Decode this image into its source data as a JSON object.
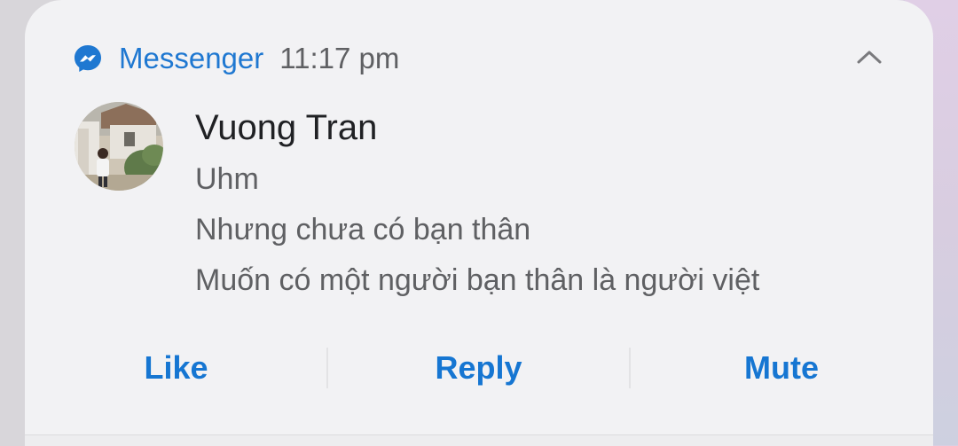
{
  "notification": {
    "app_name": "Messenger",
    "time": "11:17 pm",
    "app_icon": "messenger-icon",
    "collapse_icon": "chevron-up-icon",
    "sender": "Vuong Tran",
    "messages": [
      "Uhm",
      "Nhưng chưa có bạn thân",
      "Muốn có một người bạn thân là người việt"
    ],
    "actions": {
      "like": "Like",
      "reply": "Reply",
      "mute": "Mute"
    }
  },
  "colors": {
    "accent": "#1676d2",
    "app_name": "#1f78d1",
    "card": "#f2f2f4",
    "sender": "#202124",
    "body_text": "#5f6063"
  }
}
